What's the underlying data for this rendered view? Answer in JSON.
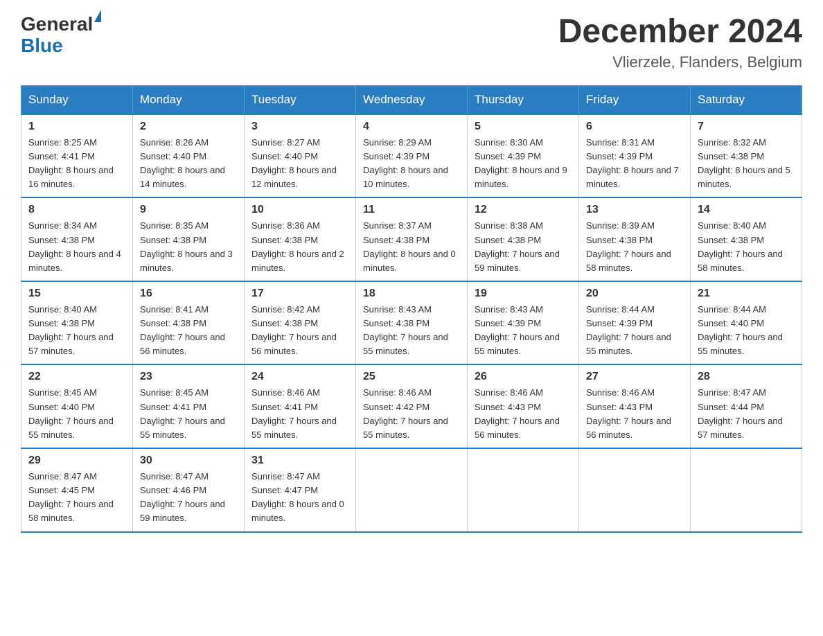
{
  "header": {
    "logo_line1": "General",
    "logo_line2": "Blue",
    "month_year": "December 2024",
    "location": "Vlierzele, Flanders, Belgium"
  },
  "days_of_week": [
    "Sunday",
    "Monday",
    "Tuesday",
    "Wednesday",
    "Thursday",
    "Friday",
    "Saturday"
  ],
  "weeks": [
    [
      {
        "day": "1",
        "sunrise": "8:25 AM",
        "sunset": "4:41 PM",
        "daylight": "8 hours and 16 minutes."
      },
      {
        "day": "2",
        "sunrise": "8:26 AM",
        "sunset": "4:40 PM",
        "daylight": "8 hours and 14 minutes."
      },
      {
        "day": "3",
        "sunrise": "8:27 AM",
        "sunset": "4:40 PM",
        "daylight": "8 hours and 12 minutes."
      },
      {
        "day": "4",
        "sunrise": "8:29 AM",
        "sunset": "4:39 PM",
        "daylight": "8 hours and 10 minutes."
      },
      {
        "day": "5",
        "sunrise": "8:30 AM",
        "sunset": "4:39 PM",
        "daylight": "8 hours and 9 minutes."
      },
      {
        "day": "6",
        "sunrise": "8:31 AM",
        "sunset": "4:39 PM",
        "daylight": "8 hours and 7 minutes."
      },
      {
        "day": "7",
        "sunrise": "8:32 AM",
        "sunset": "4:38 PM",
        "daylight": "8 hours and 5 minutes."
      }
    ],
    [
      {
        "day": "8",
        "sunrise": "8:34 AM",
        "sunset": "4:38 PM",
        "daylight": "8 hours and 4 minutes."
      },
      {
        "day": "9",
        "sunrise": "8:35 AM",
        "sunset": "4:38 PM",
        "daylight": "8 hours and 3 minutes."
      },
      {
        "day": "10",
        "sunrise": "8:36 AM",
        "sunset": "4:38 PM",
        "daylight": "8 hours and 2 minutes."
      },
      {
        "day": "11",
        "sunrise": "8:37 AM",
        "sunset": "4:38 PM",
        "daylight": "8 hours and 0 minutes."
      },
      {
        "day": "12",
        "sunrise": "8:38 AM",
        "sunset": "4:38 PM",
        "daylight": "7 hours and 59 minutes."
      },
      {
        "day": "13",
        "sunrise": "8:39 AM",
        "sunset": "4:38 PM",
        "daylight": "7 hours and 58 minutes."
      },
      {
        "day": "14",
        "sunrise": "8:40 AM",
        "sunset": "4:38 PM",
        "daylight": "7 hours and 58 minutes."
      }
    ],
    [
      {
        "day": "15",
        "sunrise": "8:40 AM",
        "sunset": "4:38 PM",
        "daylight": "7 hours and 57 minutes."
      },
      {
        "day": "16",
        "sunrise": "8:41 AM",
        "sunset": "4:38 PM",
        "daylight": "7 hours and 56 minutes."
      },
      {
        "day": "17",
        "sunrise": "8:42 AM",
        "sunset": "4:38 PM",
        "daylight": "7 hours and 56 minutes."
      },
      {
        "day": "18",
        "sunrise": "8:43 AM",
        "sunset": "4:38 PM",
        "daylight": "7 hours and 55 minutes."
      },
      {
        "day": "19",
        "sunrise": "8:43 AM",
        "sunset": "4:39 PM",
        "daylight": "7 hours and 55 minutes."
      },
      {
        "day": "20",
        "sunrise": "8:44 AM",
        "sunset": "4:39 PM",
        "daylight": "7 hours and 55 minutes."
      },
      {
        "day": "21",
        "sunrise": "8:44 AM",
        "sunset": "4:40 PM",
        "daylight": "7 hours and 55 minutes."
      }
    ],
    [
      {
        "day": "22",
        "sunrise": "8:45 AM",
        "sunset": "4:40 PM",
        "daylight": "7 hours and 55 minutes."
      },
      {
        "day": "23",
        "sunrise": "8:45 AM",
        "sunset": "4:41 PM",
        "daylight": "7 hours and 55 minutes."
      },
      {
        "day": "24",
        "sunrise": "8:46 AM",
        "sunset": "4:41 PM",
        "daylight": "7 hours and 55 minutes."
      },
      {
        "day": "25",
        "sunrise": "8:46 AM",
        "sunset": "4:42 PM",
        "daylight": "7 hours and 55 minutes."
      },
      {
        "day": "26",
        "sunrise": "8:46 AM",
        "sunset": "4:43 PM",
        "daylight": "7 hours and 56 minutes."
      },
      {
        "day": "27",
        "sunrise": "8:46 AM",
        "sunset": "4:43 PM",
        "daylight": "7 hours and 56 minutes."
      },
      {
        "day": "28",
        "sunrise": "8:47 AM",
        "sunset": "4:44 PM",
        "daylight": "7 hours and 57 minutes."
      }
    ],
    [
      {
        "day": "29",
        "sunrise": "8:47 AM",
        "sunset": "4:45 PM",
        "daylight": "7 hours and 58 minutes."
      },
      {
        "day": "30",
        "sunrise": "8:47 AM",
        "sunset": "4:46 PM",
        "daylight": "7 hours and 59 minutes."
      },
      {
        "day": "31",
        "sunrise": "8:47 AM",
        "sunset": "4:47 PM",
        "daylight": "8 hours and 0 minutes."
      },
      null,
      null,
      null,
      null
    ]
  ]
}
